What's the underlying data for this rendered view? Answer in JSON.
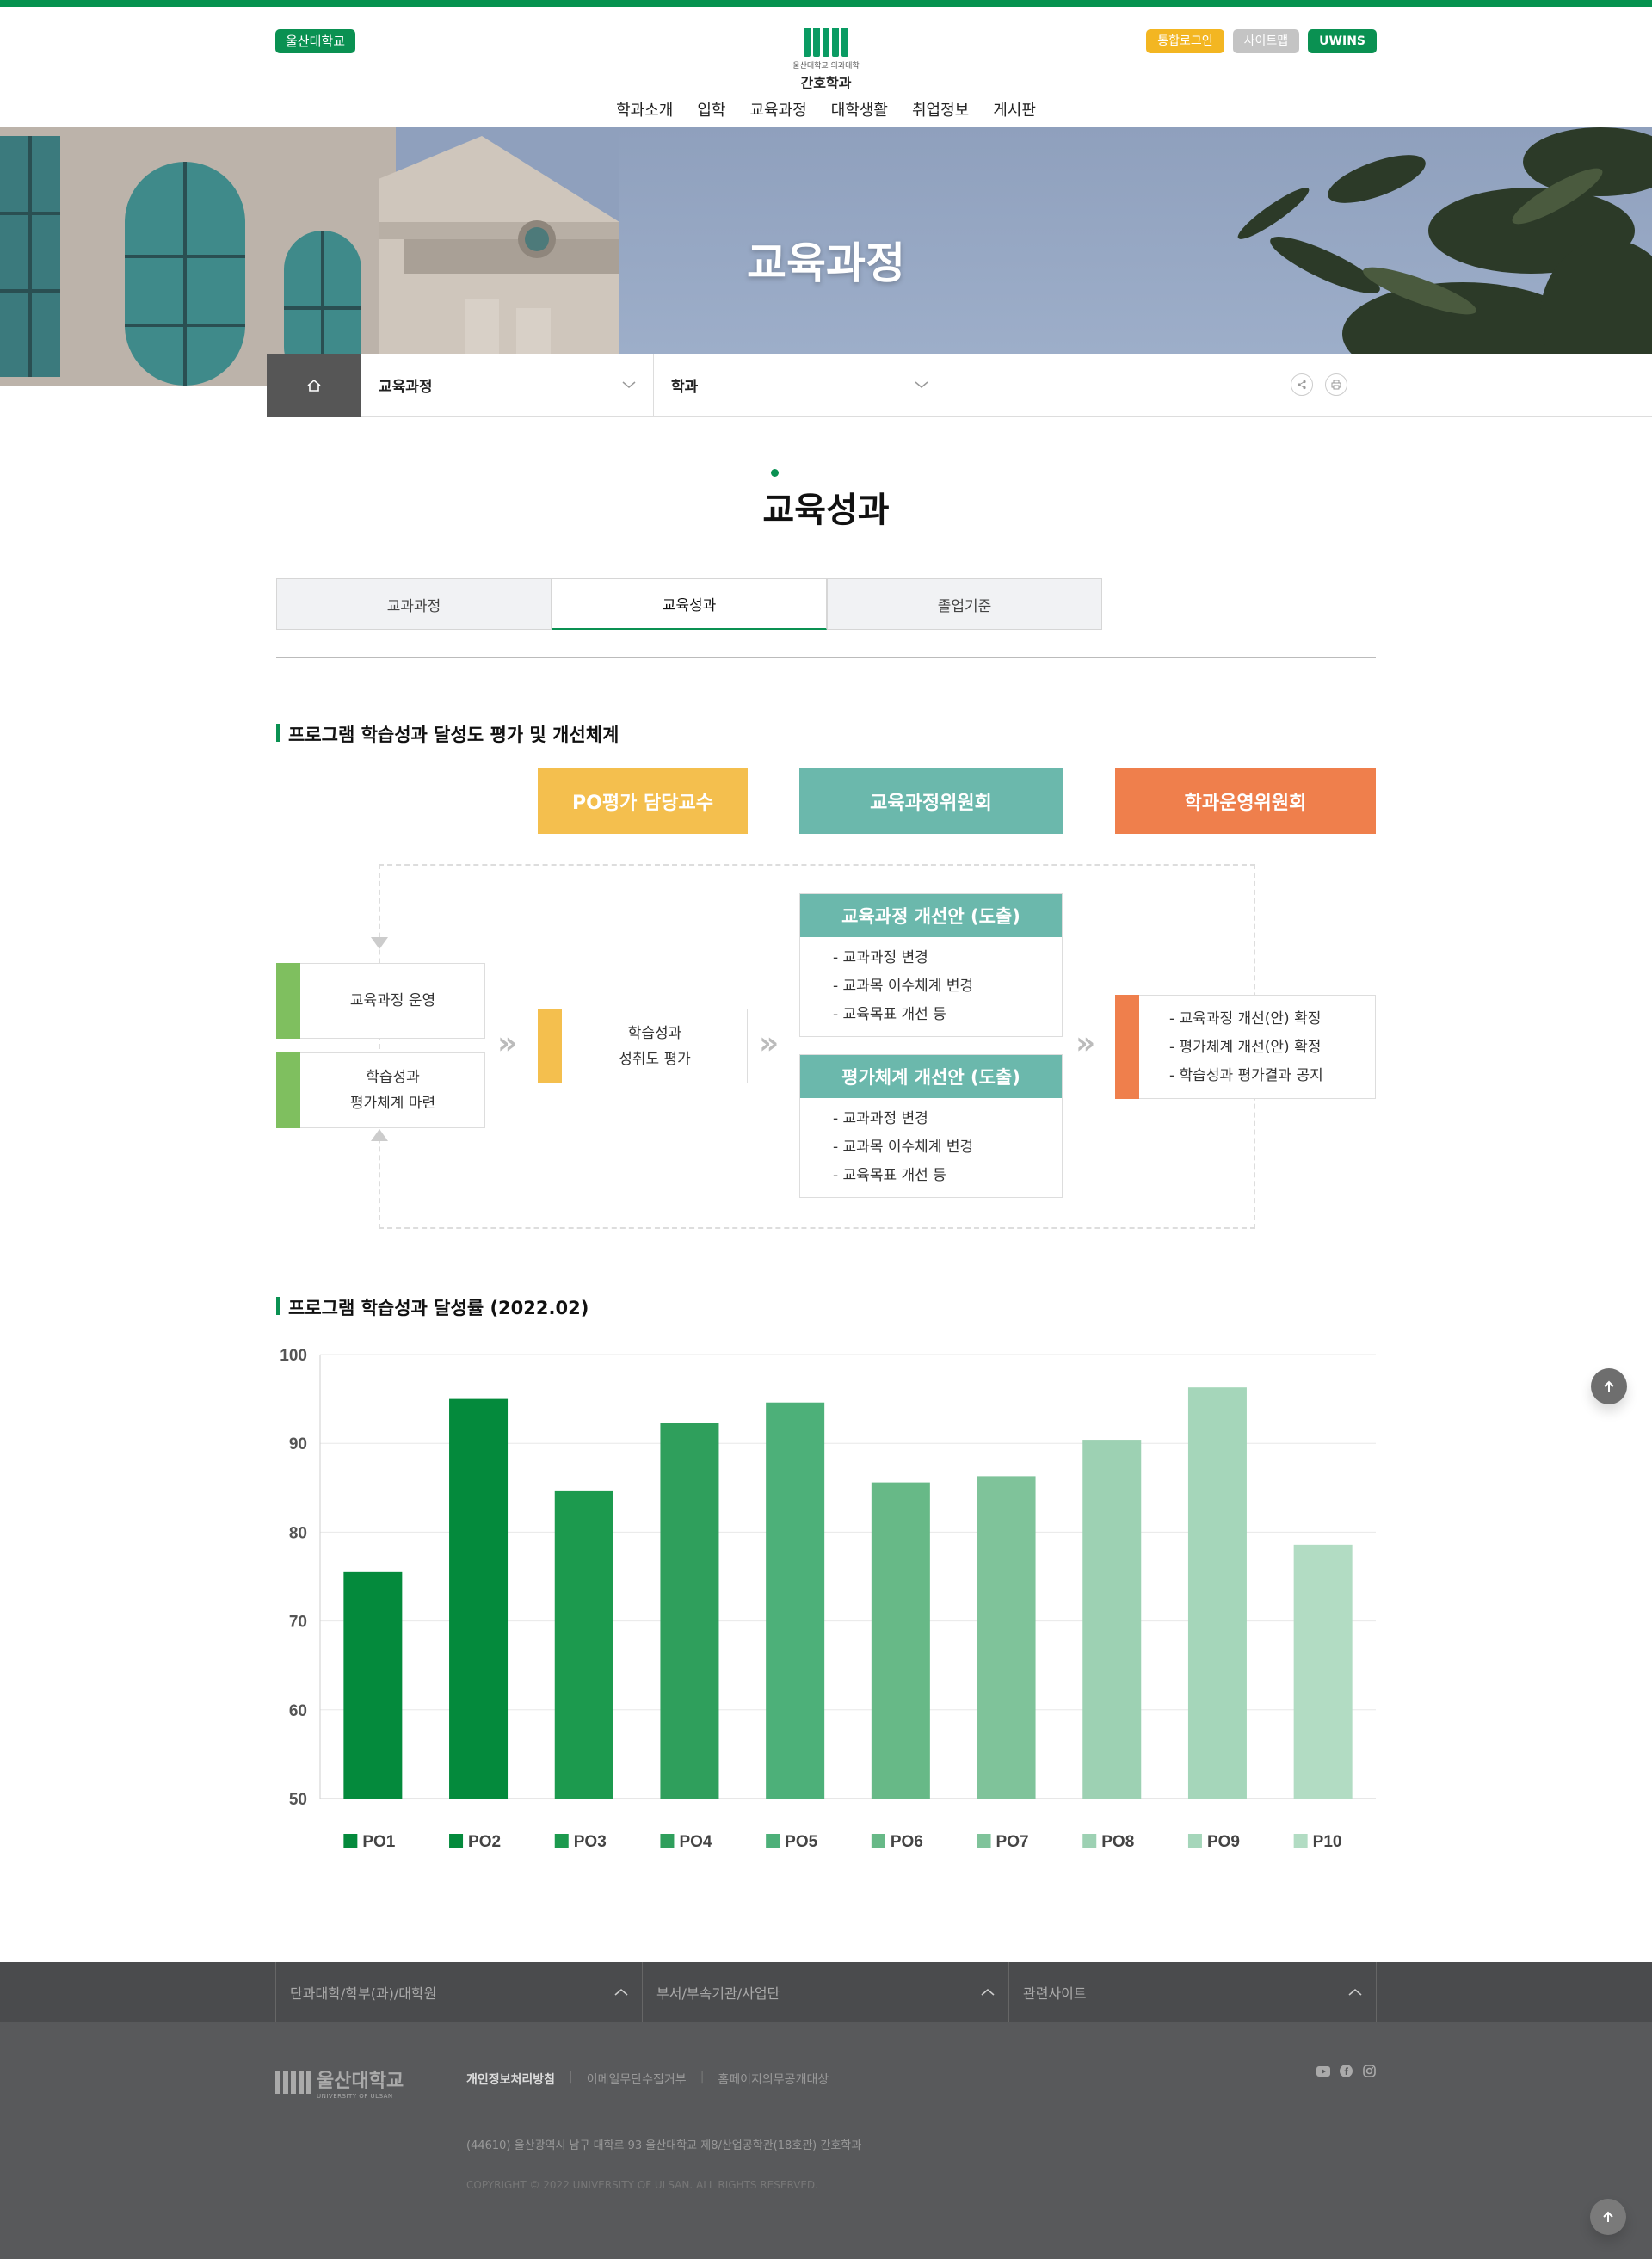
{
  "header": {
    "univ_badge": "울산대학교",
    "logo_sub": "울산대학교 의과대학",
    "logo_dept": "간호학과",
    "util": {
      "login": "통합로그인",
      "sitemap": "사이트맵",
      "uwins": "UWINS"
    },
    "nav": [
      "학과소개",
      "입학",
      "교육과정",
      "대학생활",
      "취업정보",
      "게시판"
    ]
  },
  "hero": {
    "title": "교육과정"
  },
  "location": {
    "depth1": "교육과정",
    "depth2": "학과"
  },
  "page": {
    "title": "교육성과"
  },
  "tabs": [
    {
      "label": "교과과정",
      "active": false
    },
    {
      "label": "교육성과",
      "active": true
    },
    {
      "label": "졸업기준",
      "active": false
    }
  ],
  "section1": {
    "title": "프로그램 학습성과 달성도 평가 및 개선체계",
    "roles": [
      {
        "label": "PO평가 담당교수",
        "color": "#f4bf4e"
      },
      {
        "label": "교육과정위원회",
        "color": "#6bb8ac"
      },
      {
        "label": "학과운영위원회",
        "color": "#ef7f4c"
      }
    ],
    "left_boxes": [
      {
        "line1": "교육과정 운영",
        "line2": ""
      },
      {
        "line1": "학습성과",
        "line2": "평가체계 마련"
      }
    ],
    "middle_box": {
      "line1": "학습성과",
      "line2": "성취도 평가"
    },
    "panels": [
      {
        "title": "교육과정 개선안 (도출)",
        "items": [
          "- 교과과정 변경",
          "- 교과목 이수체계 변경",
          "- 교육목표 개선 등"
        ]
      },
      {
        "title": "평가체계 개선안 (도출)",
        "items": [
          "- 교과과정 변경",
          "- 교과목 이수체계 변경",
          "- 교육목표 개선 등"
        ]
      }
    ],
    "result_items": [
      "- 교육과정 개선(안) 확정",
      "- 평가체계 개선(안) 확정",
      "- 학습성과 평가결과 공지"
    ],
    "colors": {
      "green": "#7fbf5f",
      "yellow": "#f4bf4e",
      "teal": "#6bb8ac",
      "orange": "#ef7f4c"
    }
  },
  "section2": {
    "title": "프로그램 학습성과 달성률 (2022.02)"
  },
  "chart_data": {
    "type": "bar",
    "categories": [
      "PO1",
      "PO2",
      "PO3",
      "PO4",
      "PO5",
      "PO6",
      "PO7",
      "PO8",
      "PO9",
      "P10"
    ],
    "values": [
      75.5,
      95.0,
      84.7,
      92.3,
      94.6,
      85.6,
      86.3,
      90.4,
      96.3,
      78.6
    ],
    "colors": [
      "#048a3c",
      "#048a3c",
      "#1c9a4e",
      "#2f9f5c",
      "#4db079",
      "#67b987",
      "#7fc39a",
      "#9dd1b3",
      "#a5d6ba",
      "#b2dcc3"
    ],
    "ylim": [
      50,
      100
    ],
    "yticks": [
      100,
      90,
      80,
      70,
      60,
      50
    ],
    "title": "",
    "xlabel": "",
    "ylabel": "",
    "grid": true,
    "legend": "bottom"
  },
  "footer": {
    "selects": [
      "단과대학/학부(과)/대학원",
      "부서/부속기관/사업단",
      "관련사이트"
    ],
    "logo_name": "울산대학교",
    "logo_en": "UNIVERSITY OF ULSAN",
    "links": [
      "개인정보처리방침",
      "이메일무단수집거부",
      "홈페이지의무공개대상"
    ],
    "address": "(44610) 울산광역시 남구 대학로 93 울산대학교 제8/산업공학관(18호관) 간호학과",
    "copyright": "COPYRIGHT © 2022 UNIVERSITY OF ULSAN. ALL RIGHTS RESERVED."
  }
}
